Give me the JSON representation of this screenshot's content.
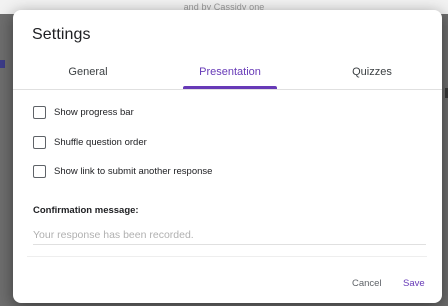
{
  "background": {
    "top_text": "and by Cassidy one"
  },
  "dialog": {
    "title": "Settings",
    "tabs": [
      {
        "label": "General",
        "active": false
      },
      {
        "label": "Presentation",
        "active": true
      },
      {
        "label": "Quizzes",
        "active": false
      }
    ],
    "options": [
      {
        "label": "Show progress bar",
        "checked": false
      },
      {
        "label": "Shuffle question order",
        "checked": false
      },
      {
        "label": "Show link to submit another response",
        "checked": false
      }
    ],
    "confirmation": {
      "label": "Confirmation message:",
      "placeholder": "Your response has been recorded.",
      "value": ""
    },
    "buttons": {
      "cancel": "Cancel",
      "save": "Save"
    }
  },
  "colors": {
    "accent": "#673ab7",
    "text_primary": "#202124",
    "text_secondary": "#5f6368",
    "divider": "#e0e0e0"
  }
}
